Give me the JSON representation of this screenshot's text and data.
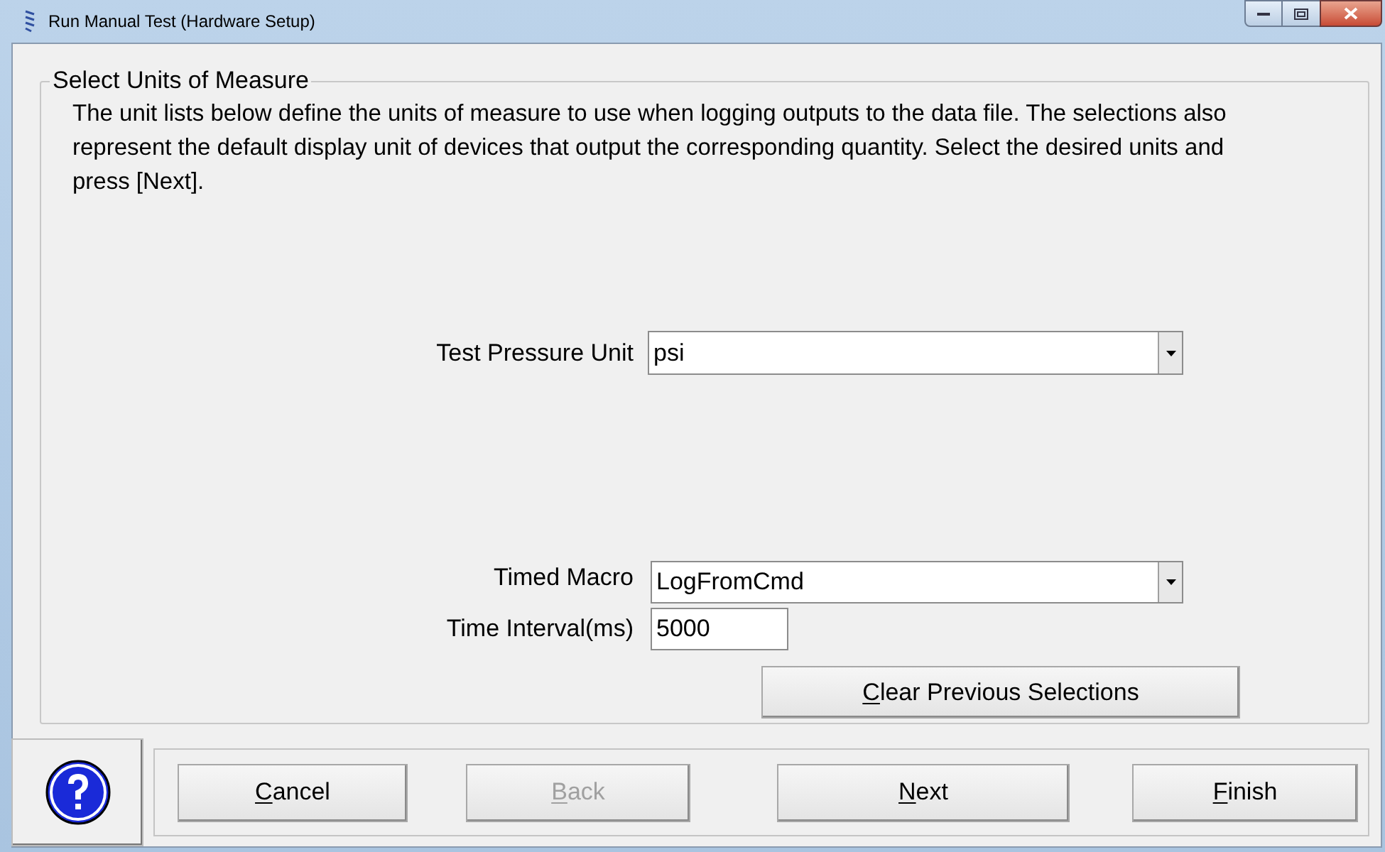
{
  "window": {
    "title": "Run Manual Test (Hardware Setup)"
  },
  "group": {
    "title": "Select Units of Measure",
    "description": "The unit lists below define the units of measure to use when logging outputs to the data file. The selections also represent the default display unit of devices that output the corresponding quantity. Select the desired units and press [Next]."
  },
  "pressure": {
    "label": "Test Pressure Unit",
    "value": "psi"
  },
  "macro": {
    "label": "Timed Macro",
    "value": "LogFromCmd"
  },
  "interval": {
    "label": "Time Interval(ms)",
    "value": "5000"
  },
  "clear_button": {
    "label": "Clear Previous Selections",
    "mnemonic": true
  },
  "buttons": [
    {
      "label": "Cancel",
      "disabled": false,
      "mnemonic": true
    },
    {
      "label": "Back",
      "disabled": true,
      "mnemonic": true
    },
    {
      "label": "Next",
      "disabled": false,
      "mnemonic": true
    },
    {
      "label": "Finish",
      "disabled": false,
      "mnemonic": true
    }
  ]
}
